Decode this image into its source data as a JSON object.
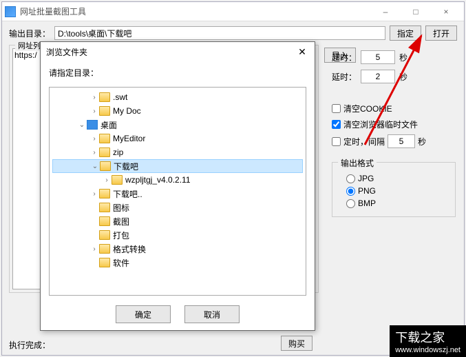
{
  "window": {
    "title": "网址批量截图工具",
    "minimize": "–",
    "maximize": "□",
    "close": "×"
  },
  "output_row": {
    "label": "输出目录：",
    "path": "D:\\tools\\桌面\\下载吧",
    "btn_locate": "指定",
    "btn_open": "打开"
  },
  "url_section": {
    "legend": "网址列表",
    "sample": "https:/",
    "btn_import": "导入"
  },
  "right": {
    "timeout_label": "超时：",
    "timeout_value": "5",
    "delay_label": "延时：",
    "delay_value": "2",
    "unit": "秒",
    "chk_clear_cookie": "清空COOKIE",
    "chk_clear_temp": "清空浏览器临时文件",
    "chk_timer_prefix": "定时，间隔",
    "timer_value": "5",
    "chk_timer_suffix": "秒",
    "clear_cookie_checked": false,
    "clear_temp_checked": true,
    "timer_checked": false
  },
  "outfmt": {
    "legend": "输出格式",
    "jpg": "JPG",
    "png": "PNG",
    "bmp": "BMP",
    "selected": "PNG"
  },
  "bottom": {
    "status_label": "执行完成：",
    "btn_buy": "购买"
  },
  "dialog": {
    "title": "浏览文件夹",
    "close": "✕",
    "prompt": "请指定目录：",
    "btn_ok": "确定",
    "btn_cancel": "取消",
    "tree": [
      {
        "indent": 3,
        "arrow": "›",
        "icon": "folder-yellow",
        "label": ".swt"
      },
      {
        "indent": 3,
        "arrow": "›",
        "icon": "folder-yellow",
        "label": "My Doc"
      },
      {
        "indent": 2,
        "arrow": "⌄",
        "icon": "folder-blue",
        "label": "桌面"
      },
      {
        "indent": 3,
        "arrow": "›",
        "icon": "folder-yellow",
        "label": "MyEditor"
      },
      {
        "indent": 3,
        "arrow": "›",
        "icon": "folder-yellow",
        "label": "zip"
      },
      {
        "indent": 3,
        "arrow": "⌄",
        "icon": "folder-yellow",
        "label": "下载吧",
        "selected": true
      },
      {
        "indent": 4,
        "arrow": "›",
        "icon": "folder-yellow",
        "label": "wzpljtgj_v4.0.2.11"
      },
      {
        "indent": 3,
        "arrow": "›",
        "icon": "folder-yellow",
        "label": "下载吧.."
      },
      {
        "indent": 3,
        "arrow": "",
        "icon": "folder-yellow",
        "label": "图标"
      },
      {
        "indent": 3,
        "arrow": "",
        "icon": "folder-yellow",
        "label": "截图"
      },
      {
        "indent": 3,
        "arrow": "",
        "icon": "folder-yellow",
        "label": "打包"
      },
      {
        "indent": 3,
        "arrow": "›",
        "icon": "folder-yellow",
        "label": "格式转换"
      },
      {
        "indent": 3,
        "arrow": "",
        "icon": "folder-yellow",
        "label": "软件"
      }
    ]
  },
  "watermark": {
    "big": "下载之家",
    "url": "www.windowszj.net"
  }
}
